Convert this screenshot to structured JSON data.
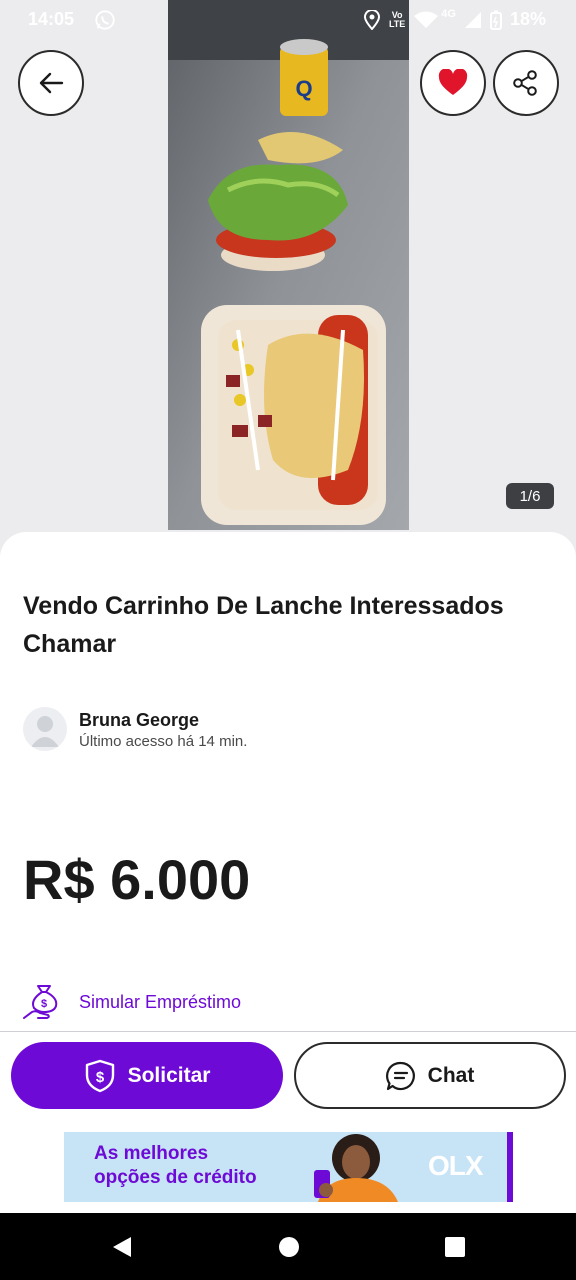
{
  "status_bar": {
    "time": "14:05",
    "network_top": "Vo",
    "network_bottom": "LTE",
    "signal_label": "4G",
    "battery": "18%",
    "icons": [
      "whatsapp-icon",
      "location-icon",
      "wifi-icon",
      "signal-icon",
      "battery-icon"
    ]
  },
  "gallery": {
    "counter": "1/6"
  },
  "listing": {
    "title": "Vendo Carrinho De Lanche Interessados Chamar",
    "price": "R$ 6.000"
  },
  "seller": {
    "name": "Bruna George",
    "last_seen": "Último acesso há 14 min."
  },
  "loan": {
    "label": "Simular Empréstimo"
  },
  "actions": {
    "primary_label": "Solicitar",
    "secondary_label": "Chat"
  },
  "banner": {
    "line1": "As melhores",
    "line2": "opções de crédito",
    "logo": "OLX"
  },
  "colors": {
    "accent": "#6e0ad6",
    "favorite": "#e0142b",
    "text": "#1a1a1a",
    "banner_bg": "#c7e4f7"
  }
}
